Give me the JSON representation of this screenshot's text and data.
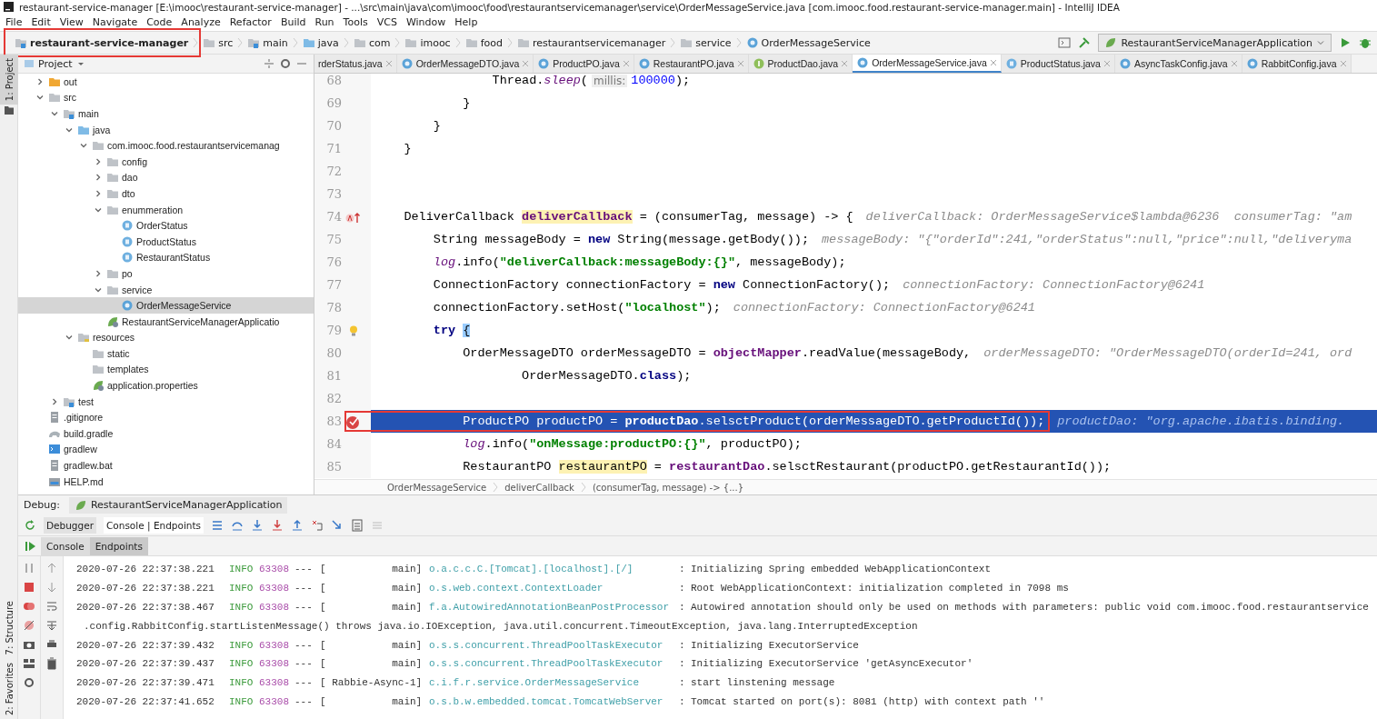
{
  "window": {
    "title": "restaurant-service-manager [E:\\imooc\\restaurant-service-manager] - ...\\src\\main\\java\\com\\imooc\\food\\restaurantservicemanager\\service\\OrderMessageService.java [com.imooc.food.restaurant-service-manager.main] - IntelliJ IDEA"
  },
  "menu": [
    "File",
    "Edit",
    "View",
    "Navigate",
    "Code",
    "Analyze",
    "Refactor",
    "Build",
    "Run",
    "Tools",
    "VCS",
    "Window",
    "Help"
  ],
  "nav_bar": {
    "crumbs": [
      {
        "label": "restaurant-service-manager",
        "kind": "module",
        "annotated": true
      },
      {
        "label": "src",
        "kind": "folder",
        "annotated": false
      },
      {
        "label": "main",
        "kind": "source",
        "annotated": false
      },
      {
        "label": "java",
        "kind": "java",
        "annotated": false
      },
      {
        "label": "com",
        "kind": "folder",
        "annotated": false
      },
      {
        "label": "imooc",
        "kind": "folder",
        "annotated": false
      },
      {
        "label": "food",
        "kind": "folder",
        "annotated": false
      },
      {
        "label": "restaurantservicemanager",
        "kind": "folder",
        "annotated": false
      },
      {
        "label": "service",
        "kind": "folder",
        "annotated": false
      },
      {
        "label": "OrderMessageService",
        "kind": "class",
        "annotated": false
      }
    ],
    "run_config": "RestaurantServiceManagerApplication"
  },
  "side_strip": {
    "top": [
      {
        "label": "1: Project",
        "selected": true
      }
    ],
    "bottom": [
      {
        "label": "7: Structure",
        "selected": false
      },
      {
        "label": "2: Favorites",
        "selected": false
      }
    ]
  },
  "project_panel": {
    "title": "Project",
    "tree": [
      {
        "label": "out",
        "kind": "output",
        "expanded": false,
        "selected": false
      },
      {
        "label": "src",
        "kind": "folder",
        "expanded": true,
        "selected": false,
        "children": [
          {
            "label": "main",
            "kind": "source",
            "expanded": true,
            "selected": false,
            "children": [
              {
                "label": "java",
                "kind": "java",
                "expanded": true,
                "selected": false,
                "children": [
                  {
                    "label": "com.imooc.food.restaurantservicemanag",
                    "kind": "package",
                    "expanded": true,
                    "selected": false,
                    "children": [
                      {
                        "label": "config",
                        "kind": "package",
                        "expanded": false,
                        "selected": false
                      },
                      {
                        "label": "dao",
                        "kind": "package",
                        "expanded": false,
                        "selected": false
                      },
                      {
                        "label": "dto",
                        "kind": "package",
                        "expanded": false,
                        "selected": false
                      },
                      {
                        "label": "enummeration",
                        "kind": "package",
                        "expanded": true,
                        "selected": false,
                        "children": [
                          {
                            "label": "OrderStatus",
                            "kind": "enum",
                            "selected": false
                          },
                          {
                            "label": "ProductStatus",
                            "kind": "enum",
                            "selected": false
                          },
                          {
                            "label": "RestaurantStatus",
                            "kind": "enum",
                            "selected": false
                          }
                        ]
                      },
                      {
                        "label": "po",
                        "kind": "package",
                        "expanded": false,
                        "selected": false
                      },
                      {
                        "label": "service",
                        "kind": "package",
                        "expanded": true,
                        "selected": false,
                        "children": [
                          {
                            "label": "OrderMessageService",
                            "kind": "class",
                            "selected": true
                          }
                        ]
                      },
                      {
                        "label": "RestaurantServiceManagerApplicatio",
                        "kind": "spring",
                        "selected": false
                      }
                    ]
                  }
                ]
              },
              {
                "label": "resources",
                "kind": "resources",
                "expanded": true,
                "selected": false,
                "children": [
                  {
                    "label": "static",
                    "kind": "package",
                    "selected": false
                  },
                  {
                    "label": "templates",
                    "kind": "package",
                    "selected": false
                  },
                  {
                    "label": "application.properties",
                    "kind": "spring",
                    "selected": false
                  }
                ]
              }
            ]
          },
          {
            "label": "test",
            "kind": "source",
            "expanded": false,
            "selected": false
          }
        ]
      },
      {
        "label": ".gitignore",
        "kind": "file",
        "selected": false
      },
      {
        "label": "build.gradle",
        "kind": "gradle",
        "selected": false
      },
      {
        "label": "gradlew",
        "kind": "script",
        "selected": false
      },
      {
        "label": "gradlew.bat",
        "kind": "file",
        "selected": false
      },
      {
        "label": "HELP.md",
        "kind": "markdown",
        "selected": false
      }
    ]
  },
  "editor_tabs": [
    {
      "label": "rderStatus.java",
      "kind": "none",
      "selected": false
    },
    {
      "label": "OrderMessageDTO.java",
      "kind": "class",
      "selected": false
    },
    {
      "label": "ProductPO.java",
      "kind": "class",
      "selected": false
    },
    {
      "label": "RestaurantPO.java",
      "kind": "class",
      "selected": false
    },
    {
      "label": "ProductDao.java",
      "kind": "interface",
      "selected": false
    },
    {
      "label": "OrderMessageService.java",
      "kind": "class",
      "selected": true
    },
    {
      "label": "ProductStatus.java",
      "kind": "enum",
      "selected": false
    },
    {
      "label": "AsyncTaskConfig.java",
      "kind": "class",
      "selected": false
    },
    {
      "label": "RabbitConfig.java",
      "kind": "class",
      "selected": false
    }
  ],
  "code_lines": [
    {
      "number": "68",
      "kind": "plain",
      "selected": false,
      "breakpoint": false,
      "annotated": false,
      "tokens": [
        {
          "text": "                Thread.",
          "kind": "plain"
        },
        {
          "text": "sleep",
          "kind": "static"
        },
        {
          "text": "(",
          "kind": "plain"
        },
        {
          "text": "millis:",
          "kind": "inlay"
        },
        {
          "text": "100000",
          "kind": "number"
        },
        {
          "text": ");",
          "kind": "plain"
        }
      ]
    },
    {
      "number": "69",
      "kind": "plain",
      "selected": false,
      "breakpoint": false,
      "annotated": false,
      "tokens": [
        {
          "text": "            }",
          "kind": "plain"
        }
      ]
    },
    {
      "number": "70",
      "kind": "plain",
      "selected": false,
      "breakpoint": false,
      "annotated": false,
      "tokens": [
        {
          "text": "        }",
          "kind": "plain"
        }
      ]
    },
    {
      "number": "71",
      "kind": "plain",
      "selected": false,
      "breakpoint": false,
      "annotated": false,
      "tokens": [
        {
          "text": "    }",
          "kind": "plain"
        }
      ]
    },
    {
      "number": "72",
      "kind": "plain",
      "selected": false,
      "breakpoint": false,
      "annotated": false
    },
    {
      "number": "73",
      "kind": "plain",
      "selected": false,
      "breakpoint": false,
      "annotated": false
    },
    {
      "number": "74",
      "kind": "lambda",
      "selected": false,
      "breakpoint": false,
      "annotated": false,
      "tokens": [
        {
          "text": "    DeliverCallback ",
          "kind": "plain"
        },
        {
          "text": "deliverCallback",
          "kind": "declaration"
        },
        {
          "text": " = (consumerTag, message) -> {",
          "kind": "plain"
        },
        {
          "text": "deliverCallback: OrderMessageService$lambda@6236  consumerTag: \"am",
          "kind": "hint"
        }
      ]
    },
    {
      "number": "75",
      "kind": "plain",
      "selected": false,
      "breakpoint": false,
      "annotated": false,
      "tokens": [
        {
          "text": "        String messageBody = ",
          "kind": "plain"
        },
        {
          "text": "new",
          "kind": "keyword"
        },
        {
          "text": " String(message.getBody());",
          "kind": "plain"
        },
        {
          "text": "messageBody: \"{\"orderId\":241,\"orderStatus\":null,\"price\":null,\"deliveryma",
          "kind": "hint"
        }
      ]
    },
    {
      "number": "76",
      "kind": "plain",
      "selected": false,
      "breakpoint": false,
      "annotated": false,
      "tokens": [
        {
          "text": "        log",
          "kind": "static"
        },
        {
          "text": ".info(",
          "kind": "plain"
        },
        {
          "text": "\"deliverCallback:messageBody:{}\"",
          "kind": "string"
        },
        {
          "text": ", messageBody);",
          "kind": "plain"
        }
      ]
    },
    {
      "number": "77",
      "kind": "plain",
      "selected": false,
      "breakpoint": false,
      "annotated": false,
      "tokens": [
        {
          "text": "        ConnectionFactory connectionFactory = ",
          "kind": "plain"
        },
        {
          "text": "new",
          "kind": "keyword"
        },
        {
          "text": " ConnectionFactory();",
          "kind": "plain"
        },
        {
          "text": "connectionFactory: ConnectionFactory@6241",
          "kind": "hint"
        }
      ]
    },
    {
      "number": "78",
      "kind": "plain",
      "selected": false,
      "breakpoint": false,
      "annotated": false,
      "tokens": [
        {
          "text": "        connectionFactory.setHost(",
          "kind": "plain"
        },
        {
          "text": "\"localhost\"",
          "kind": "string"
        },
        {
          "text": ");",
          "kind": "plain"
        },
        {
          "text": "connectionFactory: ConnectionFactory@6241",
          "kind": "hint"
        }
      ]
    },
    {
      "number": "79",
      "kind": "bulb",
      "selected": false,
      "breakpoint": false,
      "annotated": false,
      "tokens": [
        {
          "text": "        try ",
          "kind": "keyword"
        },
        {
          "text": "{",
          "kind": "brace"
        }
      ]
    },
    {
      "number": "80",
      "kind": "plain",
      "selected": false,
      "breakpoint": false,
      "annotated": false,
      "tokens": [
        {
          "text": "            OrderMessageDTO orderMessageDTO = ",
          "kind": "plain"
        },
        {
          "text": "objectMapper",
          "kind": "field"
        },
        {
          "text": ".readValue(messageBody,",
          "kind": "plain"
        },
        {
          "text": "orderMessageDTO: \"OrderMessageDTO(orderId=241, ord",
          "kind": "hint"
        }
      ]
    },
    {
      "number": "81",
      "kind": "plain",
      "selected": false,
      "breakpoint": false,
      "annotated": false,
      "tokens": [
        {
          "text": "                    OrderMessageDTO.",
          "kind": "plain"
        },
        {
          "text": "class",
          "kind": "keyword"
        },
        {
          "text": ");",
          "kind": "plain"
        }
      ]
    },
    {
      "number": "82",
      "kind": "plain",
      "selected": false,
      "breakpoint": false,
      "annotated": false
    },
    {
      "number": "83",
      "kind": "plain",
      "selected": true,
      "breakpoint": true,
      "annotated": true,
      "tokens": [
        {
          "text": "            ProductPO productPO = ",
          "kind": "plain"
        },
        {
          "text": "productDao",
          "kind": "field"
        },
        {
          "text": ".selsctProduct(orderMessageDTO.getProductId());",
          "kind": "plain"
        },
        {
          "text": "productDao: \"org.apache.ibatis.binding.",
          "kind": "hint"
        }
      ]
    },
    {
      "number": "84",
      "kind": "plain",
      "selected": false,
      "breakpoint": false,
      "annotated": false,
      "tokens": [
        {
          "text": "            log",
          "kind": "static"
        },
        {
          "text": ".info(",
          "kind": "plain"
        },
        {
          "text": "\"onMessage:productPO:{}\"",
          "kind": "string"
        },
        {
          "text": ", productPO);",
          "kind": "plain"
        }
      ]
    },
    {
      "number": "85",
      "kind": "plain",
      "selected": false,
      "breakpoint": false,
      "annotated": false,
      "tokens": [
        {
          "text": "            RestaurantPO ",
          "kind": "plain"
        },
        {
          "text": "restaurantPO",
          "kind": "usage"
        },
        {
          "text": " = ",
          "kind": "plain"
        },
        {
          "text": "restaurantDao",
          "kind": "field"
        },
        {
          "text": ".selsctRestaurant(productPO.getRestaurantId());",
          "kind": "plain"
        }
      ]
    }
  ],
  "code_breadcrumb": [
    "OrderMessageService",
    "deliverCallback",
    "(consumerTag, message) -> {...}"
  ],
  "debug": {
    "label": "Debug:",
    "session": "RestaurantServiceManagerApplication",
    "tabs": [
      {
        "label": "Debugger",
        "selected": false
      },
      {
        "label": "Console | Endpoints",
        "selected": true
      }
    ],
    "sub_tabs": [
      {
        "label": "Console",
        "selected": true
      },
      {
        "label": "Endpoints",
        "selected": false
      }
    ]
  },
  "console": [
    {
      "kind": "log",
      "timestamp": "2020-07-26 22:37:38.221",
      "level": "INFO",
      "pid": "63308",
      "sep": "---",
      "thread": "[           main]",
      "logger": "o.a.c.c.C.[Tomcat].[localhost].[/]",
      "colon": ":",
      "message": "Initializing Spring embedded WebApplicationContext"
    },
    {
      "kind": "log",
      "timestamp": "2020-07-26 22:37:38.221",
      "level": "INFO",
      "pid": "63308",
      "sep": "---",
      "thread": "[           main]",
      "logger": "o.s.web.context.ContextLoader",
      "colon": ":",
      "message": "Root WebApplicationContext: initialization completed in 7098 ms"
    },
    {
      "kind": "log",
      "timestamp": "2020-07-26 22:37:38.467",
      "level": "INFO",
      "pid": "63308",
      "sep": "---",
      "thread": "[           main]",
      "logger": "f.a.AutowiredAnnotationBeanPostProcessor",
      "colon": ":",
      "message": "Autowired annotation should only be used on methods with parameters: public void com.imooc.food.restaurantservice"
    },
    {
      "kind": "continuation",
      "message": ".config.RabbitConfig.startListenMessage() throws java.io.IOException, java.util.concurrent.TimeoutException, java.lang.InterruptedException"
    },
    {
      "kind": "log",
      "timestamp": "2020-07-26 22:37:39.432",
      "level": "INFO",
      "pid": "63308",
      "sep": "---",
      "thread": "[           main]",
      "logger": "o.s.s.concurrent.ThreadPoolTaskExecutor",
      "colon": ":",
      "message": "Initializing ExecutorService"
    },
    {
      "kind": "log",
      "timestamp": "2020-07-26 22:37:39.437",
      "level": "INFO",
      "pid": "63308",
      "sep": "---",
      "thread": "[           main]",
      "logger": "o.s.s.concurrent.ThreadPoolTaskExecutor",
      "colon": ":",
      "message": "Initializing ExecutorService 'getAsyncExecutor'"
    },
    {
      "kind": "log",
      "timestamp": "2020-07-26 22:37:39.471",
      "level": "INFO",
      "pid": "63308",
      "sep": "---",
      "thread": "[ Rabbie-Async-1]",
      "logger": "c.i.f.r.service.OrderMessageService",
      "colon": ":",
      "message": "start linstening message"
    },
    {
      "kind": "log",
      "timestamp": "2020-07-26 22:37:41.652",
      "level": "INFO",
      "pid": "63308",
      "sep": "---",
      "thread": "[           main]",
      "logger": "o.s.b.w.embedded.tomcat.TomcatWebServer",
      "colon": ":",
      "message": "Tomcat started on port(s): 8081 (http) with context path ''"
    }
  ]
}
